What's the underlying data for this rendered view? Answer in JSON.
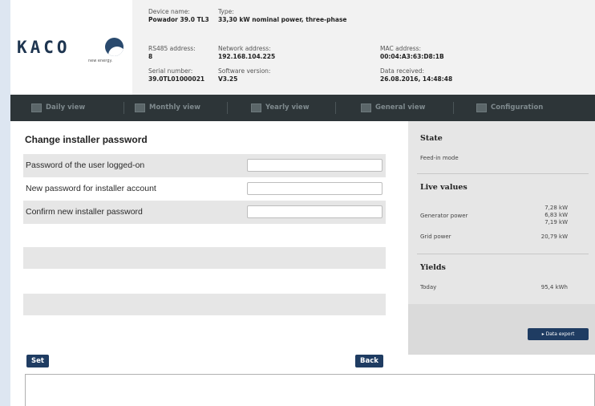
{
  "header": {
    "logo_text": "KACO",
    "logo_tagline": "new energy.",
    "device_name": {
      "label": "Device name:",
      "value": "Powador 39.0 TL3"
    },
    "type": {
      "label": "Type:",
      "value": "33,30 kW nominal power, three-phase"
    },
    "rs485": {
      "label": "RS485 address:",
      "value": "8"
    },
    "network": {
      "label": "Network address:",
      "value": "192.168.104.225"
    },
    "mac": {
      "label": "MAC address:",
      "value": "00:04:A3:63:D8:1B"
    },
    "serial": {
      "label": "Serial number:",
      "value": "39.0TL01000021"
    },
    "software": {
      "label": "Software version:",
      "value": "V3.25"
    },
    "received": {
      "label": "Data received:",
      "value": "26.08.2016, 14:48:48"
    }
  },
  "nav": {
    "items": [
      {
        "label": "Daily view",
        "icon": "chart-icon"
      },
      {
        "label": "Monthly view",
        "icon": "calendar-icon"
      },
      {
        "label": "Yearly view",
        "icon": "chart-icon"
      },
      {
        "label": "General view",
        "icon": "overview-icon"
      },
      {
        "label": "Configuration",
        "icon": "wrench-icon"
      }
    ]
  },
  "form": {
    "title": "Change installer password",
    "fields": [
      {
        "label": "Password of the user logged-on",
        "value": ""
      },
      {
        "label": "New password for installer account",
        "value": ""
      },
      {
        "label": "Confirm new installer password",
        "value": ""
      }
    ],
    "set_label": "Set",
    "back_label": "Back"
  },
  "side": {
    "state_heading": "State",
    "state_value": "Feed-in mode",
    "live_heading": "Live values",
    "generator_label": "Generator power",
    "generator_values": [
      "7,28 kW",
      "6,83 kW",
      "7,19 kW"
    ],
    "grid_label": "Grid power",
    "grid_value": "20,79 kW",
    "yields_heading": "Yields",
    "today_label": "Today",
    "today_value": "95,4 kWh",
    "export_label": "▸ Data export"
  },
  "colors": {
    "nav_bg": "#2d3538",
    "button_bg": "#1f3c62",
    "row_shade": "#e6e6e6"
  }
}
